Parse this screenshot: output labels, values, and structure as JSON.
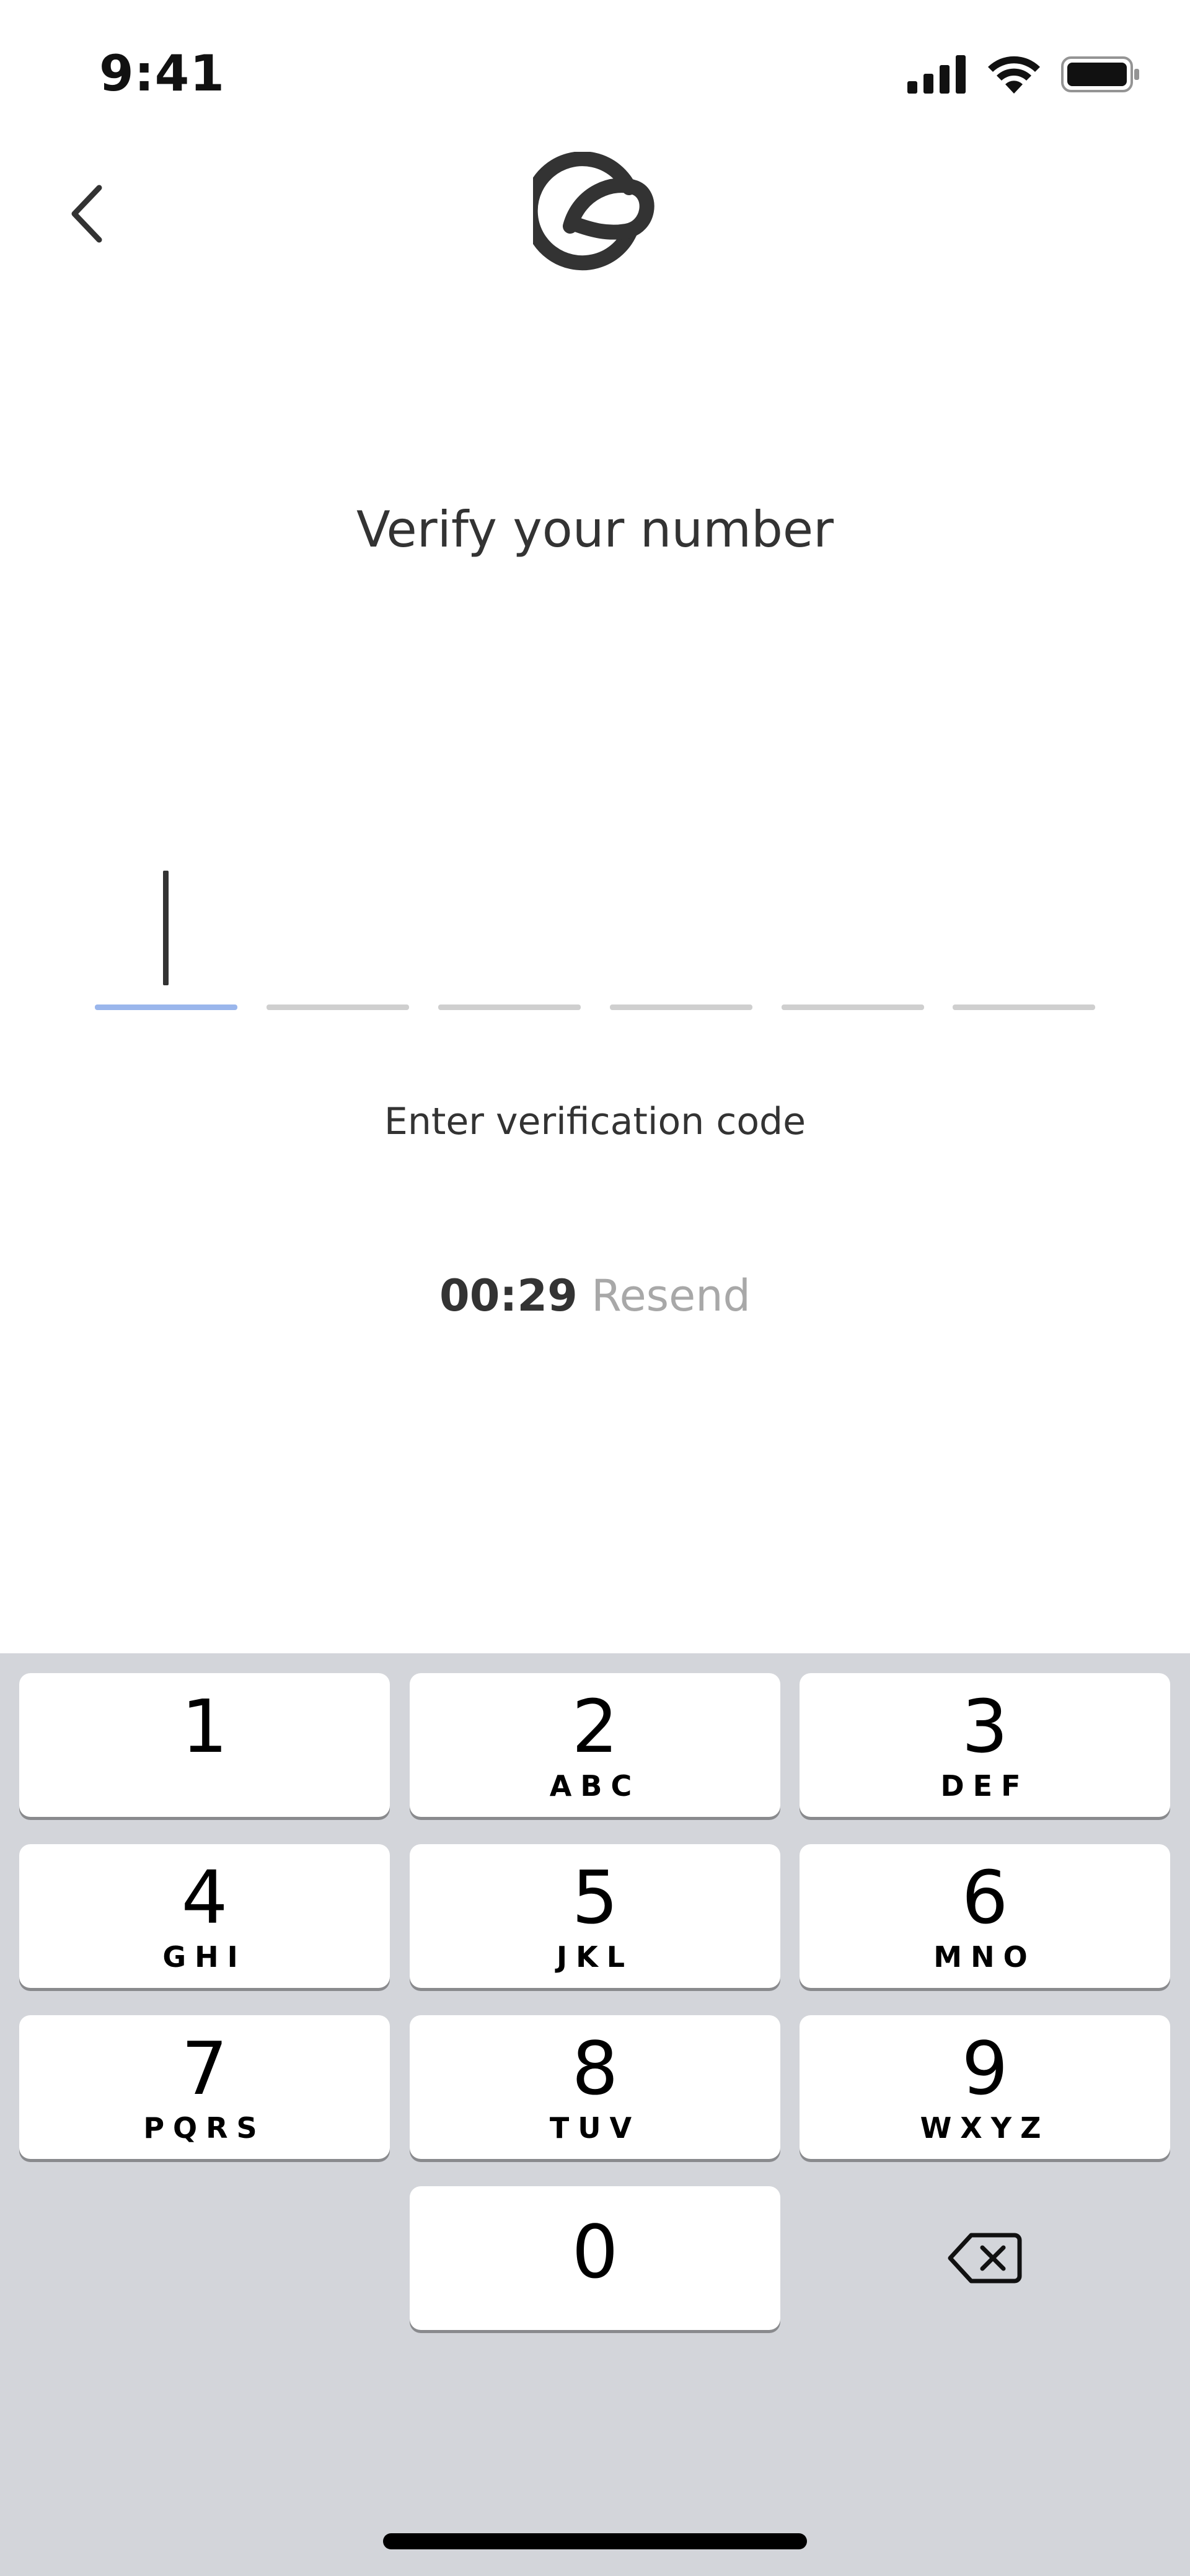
{
  "status_bar": {
    "time": "9:41",
    "icons": [
      "cellular-signal-icon",
      "wifi-icon",
      "battery-icon"
    ]
  },
  "header": {
    "back_icon": "chevron-left-icon",
    "logo_icon": "app-logo-icon"
  },
  "title": "Verify your number",
  "code_input": {
    "length": 6,
    "values": [
      "",
      "",
      "",
      "",
      "",
      ""
    ],
    "active_index": 0,
    "active_color": "#9ab6ec",
    "inactive_color": "#cfcfcf"
  },
  "hint": "Enter verification code",
  "timer": {
    "countdown": "00:29",
    "resend_label": "Resend"
  },
  "keypad": {
    "keys": [
      {
        "num": "1",
        "letters": ""
      },
      {
        "num": "2",
        "letters": "ABC"
      },
      {
        "num": "3",
        "letters": "DEF"
      },
      {
        "num": "4",
        "letters": "GHI"
      },
      {
        "num": "5",
        "letters": "JKL"
      },
      {
        "num": "6",
        "letters": "MNO"
      },
      {
        "num": "7",
        "letters": "PQRS"
      },
      {
        "num": "8",
        "letters": "TUV"
      },
      {
        "num": "9",
        "letters": "WXYZ"
      },
      {
        "num": "0",
        "letters": ""
      }
    ],
    "delete_icon": "backspace-icon",
    "background": "#d3d5da"
  }
}
